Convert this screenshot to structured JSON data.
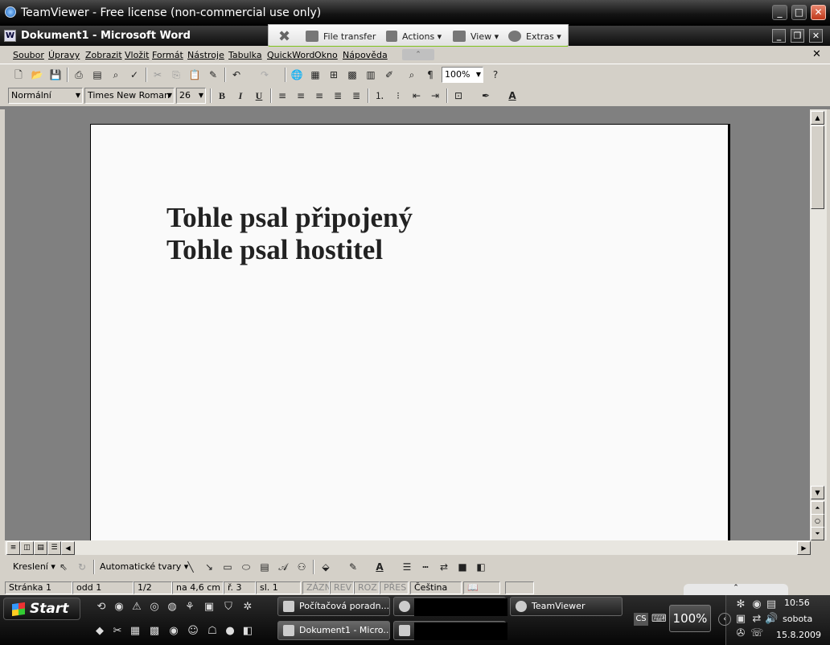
{
  "teamviewer": {
    "title": "TeamViewer - Free license (non-commercial use only)",
    "toolbar": {
      "file_transfer": "File transfer",
      "actions": "Actions",
      "view": "View",
      "extras": "Extras"
    }
  },
  "word": {
    "title": "Dokument1 - Microsoft Word",
    "menu": [
      "Soubor",
      "Úpravy",
      "Zobrazit",
      "Vložit",
      "Formát",
      "Nástroje",
      "Tabulka",
      "QuickWord",
      "Okno",
      "Nápověda"
    ],
    "style": "Normální",
    "font": "Times New Roman",
    "size": "26",
    "zoom": "100%",
    "document_lines": [
      "Tohle psal připojený",
      "Tohle psal hostitel"
    ],
    "draw": {
      "label": "Kreslení",
      "autoshapes": "Automatické tvary"
    },
    "status": {
      "page": "Stránka  1",
      "section": "odd  1",
      "pages": "1/2",
      "at": "na  4,6 cm",
      "line": "ř.  3",
      "col": "sl.  1",
      "rec": "ZÁZN",
      "trk": "REV",
      "ext": "ROZ",
      "ovr": "PŘES",
      "lang": "Čeština"
    }
  },
  "taskbar": {
    "start": "Start",
    "buttons": [
      "Počítačová poradn...",
      "TeamViewer",
      "Dokument1 - Micro..."
    ],
    "lang": "CS",
    "zoom": "100%",
    "time": "10:56",
    "day": "sobota",
    "date": "15.8.2009"
  }
}
